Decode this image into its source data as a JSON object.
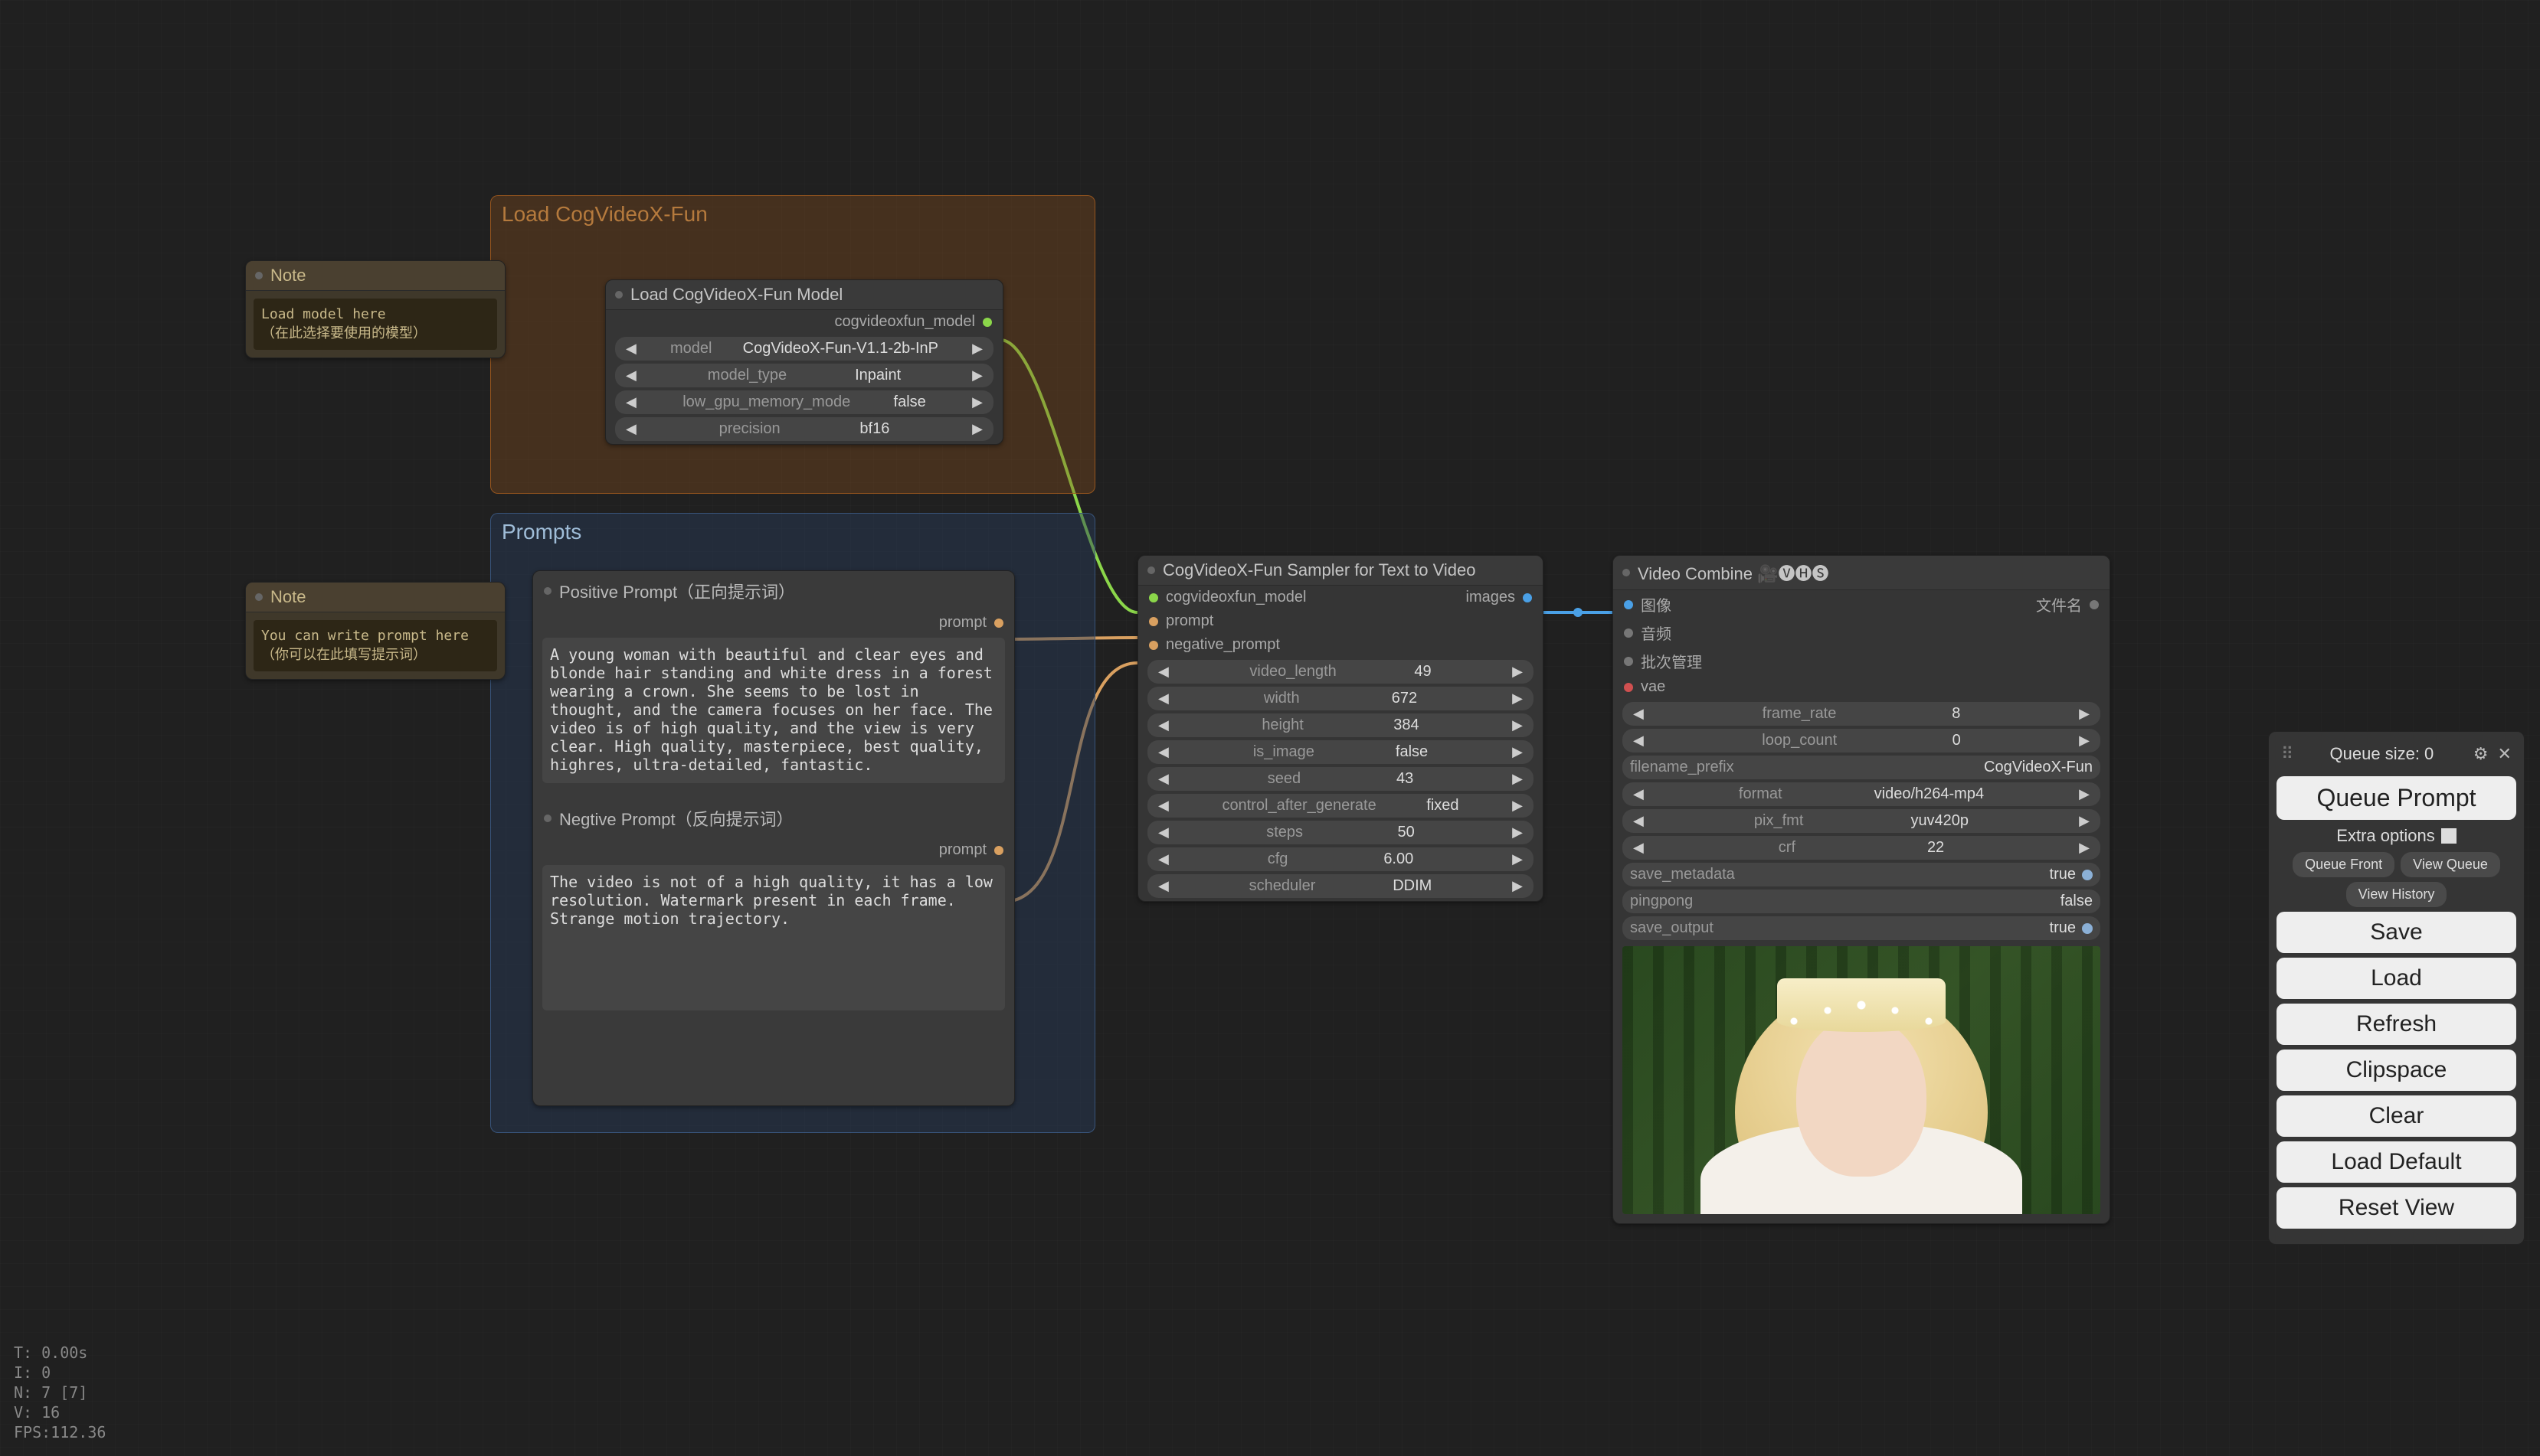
{
  "groups": {
    "load": {
      "title": "Load CogVideoX-Fun"
    },
    "prompts": {
      "title": "Prompts"
    }
  },
  "notes": {
    "note1": {
      "title": "Note",
      "body": "Load model here\n（在此选择要使用的模型）"
    },
    "note2": {
      "title": "Note",
      "body": "You can write prompt here\n（你可以在此填写提示词）"
    }
  },
  "load_model": {
    "title": "Load CogVideoX-Fun Model",
    "out_label": "cogvideoxfun_model",
    "params": {
      "model": {
        "label": "model",
        "value": "CogVideoX-Fun-V1.1-2b-InP"
      },
      "model_type": {
        "label": "model_type",
        "value": "Inpaint"
      },
      "low_mem": {
        "label": "low_gpu_memory_mode",
        "value": "false"
      },
      "precision": {
        "label": "precision",
        "value": "bf16"
      }
    }
  },
  "prompts": {
    "pos_title": "Positive Prompt（正向提示词）",
    "neg_title": "Negtive Prompt（反向提示词）",
    "prompt_out": "prompt",
    "positive": "A young woman with beautiful and clear eyes and blonde hair standing and white dress in a forest wearing a crown. She seems to be lost in thought, and the camera focuses on her face. The video is of high quality, and the view is very clear. High quality, masterpiece, best quality, highres, ultra-detailed, fantastic.",
    "negative": "The video is not of a high quality, it has a low resolution. Watermark present in each frame. Strange motion trajectory."
  },
  "sampler": {
    "title": "CogVideoX-Fun Sampler for Text to Video",
    "in_model": "cogvideoxfun_model",
    "in_prompt": "prompt",
    "in_neg": "negative_prompt",
    "out_images": "images",
    "params": {
      "video_length": {
        "label": "video_length",
        "value": "49"
      },
      "width": {
        "label": "width",
        "value": "672"
      },
      "height": {
        "label": "height",
        "value": "384"
      },
      "is_image": {
        "label": "is_image",
        "value": "false"
      },
      "seed": {
        "label": "seed",
        "value": "43"
      },
      "control_after_generate": {
        "label": "control_after_generate",
        "value": "fixed"
      },
      "steps": {
        "label": "steps",
        "value": "50"
      },
      "cfg": {
        "label": "cfg",
        "value": "6.00"
      },
      "scheduler": {
        "label": "scheduler",
        "value": "DDIM"
      }
    }
  },
  "combine": {
    "title": "Video Combine 🎥🅥🅗🅢",
    "in_image": "图像",
    "in_audio": "音频",
    "in_batch": "批次管理",
    "in_vae": "vae",
    "out_file": "文件名",
    "params": {
      "frame_rate": {
        "label": "frame_rate",
        "value": "8"
      },
      "loop_count": {
        "label": "loop_count",
        "value": "0"
      },
      "filename_prefix": {
        "label": "filename_prefix",
        "value": "CogVideoX-Fun"
      },
      "format": {
        "label": "format",
        "value": "video/h264-mp4"
      },
      "pix_fmt": {
        "label": "pix_fmt",
        "value": "yuv420p"
      },
      "crf": {
        "label": "crf",
        "value": "22"
      },
      "save_metadata": {
        "label": "save_metadata",
        "value": "true"
      },
      "pingpong": {
        "label": "pingpong",
        "value": "false"
      },
      "save_output": {
        "label": "save_output",
        "value": "true"
      }
    }
  },
  "panel": {
    "queue_size": "Queue size: 0",
    "queue_prompt": "Queue Prompt",
    "extra_options": "Extra options",
    "queue_front": "Queue Front",
    "view_queue": "View Queue",
    "view_history": "View History",
    "save": "Save",
    "load": "Load",
    "refresh": "Refresh",
    "clipspace": "Clipspace",
    "clear": "Clear",
    "load_default": "Load Default",
    "reset_view": "Reset View"
  },
  "stats": {
    "t": "T: 0.00s",
    "i": "I: 0",
    "n": "N: 7 [7]",
    "v": "V: 16",
    "fps": "FPS:112.36"
  }
}
